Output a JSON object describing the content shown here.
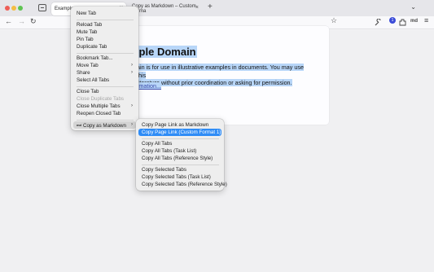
{
  "tabs": {
    "active_title": "Example D",
    "inactive_title": "Copy as Markdown – Custom Forma",
    "close_glyph": "×",
    "new_tab_glyph": "+",
    "list_glyph": "⌄"
  },
  "nav": {
    "back": "←",
    "forward": "→",
    "reload": "↻",
    "bookmark": "☆",
    "badge": "1",
    "ext_label": "md",
    "menu": "≡"
  },
  "page": {
    "heading": "mple Domain",
    "para_line1": "ain is for use in illustrative examples in documents. You may use this",
    "para_line2": "literature without prior coordination or asking for permission.",
    "more_link": "rmation..."
  },
  "context_menu": {
    "new_tab": "New Tab",
    "reload_tab": "Reload Tab",
    "mute_tab": "Mute Tab",
    "pin_tab": "Pin Tab",
    "duplicate_tab": "Duplicate Tab",
    "bookmark_tab": "Bookmark Tab...",
    "move_tab": "Move Tab",
    "share": "Share",
    "select_all_tabs": "Select All Tabs",
    "close_tab": "Close Tab",
    "close_duplicate_tabs": "Close Duplicate Tabs",
    "close_multiple_tabs": "Close Multiple Tabs",
    "reopen_closed_tab": "Reopen Closed Tab",
    "copy_as_markdown": "Copy as Markdown",
    "md_icon": "md",
    "arrow": "›"
  },
  "submenu": {
    "copy_page_link": "Copy Page Link as Markdown",
    "copy_page_link_custom": "Copy Page Link (Custom Format 1)",
    "copy_all_tabs": "Copy All Tabs",
    "copy_all_tabs_task": "Copy All Tabs (Task List)",
    "copy_all_tabs_ref": "Copy All Tabs (Reference Style)",
    "copy_selected_tabs": "Copy Selected Tabs",
    "copy_selected_tabs_task": "Copy Selected Tabs (Task List)",
    "copy_selected_tabs_ref": "Copy Selected Tabs (Reference Style)"
  },
  "colors": {
    "selection_highlight": "#b8d6f8",
    "menu_selected": "#2f8cf6",
    "link": "#3949ab"
  }
}
